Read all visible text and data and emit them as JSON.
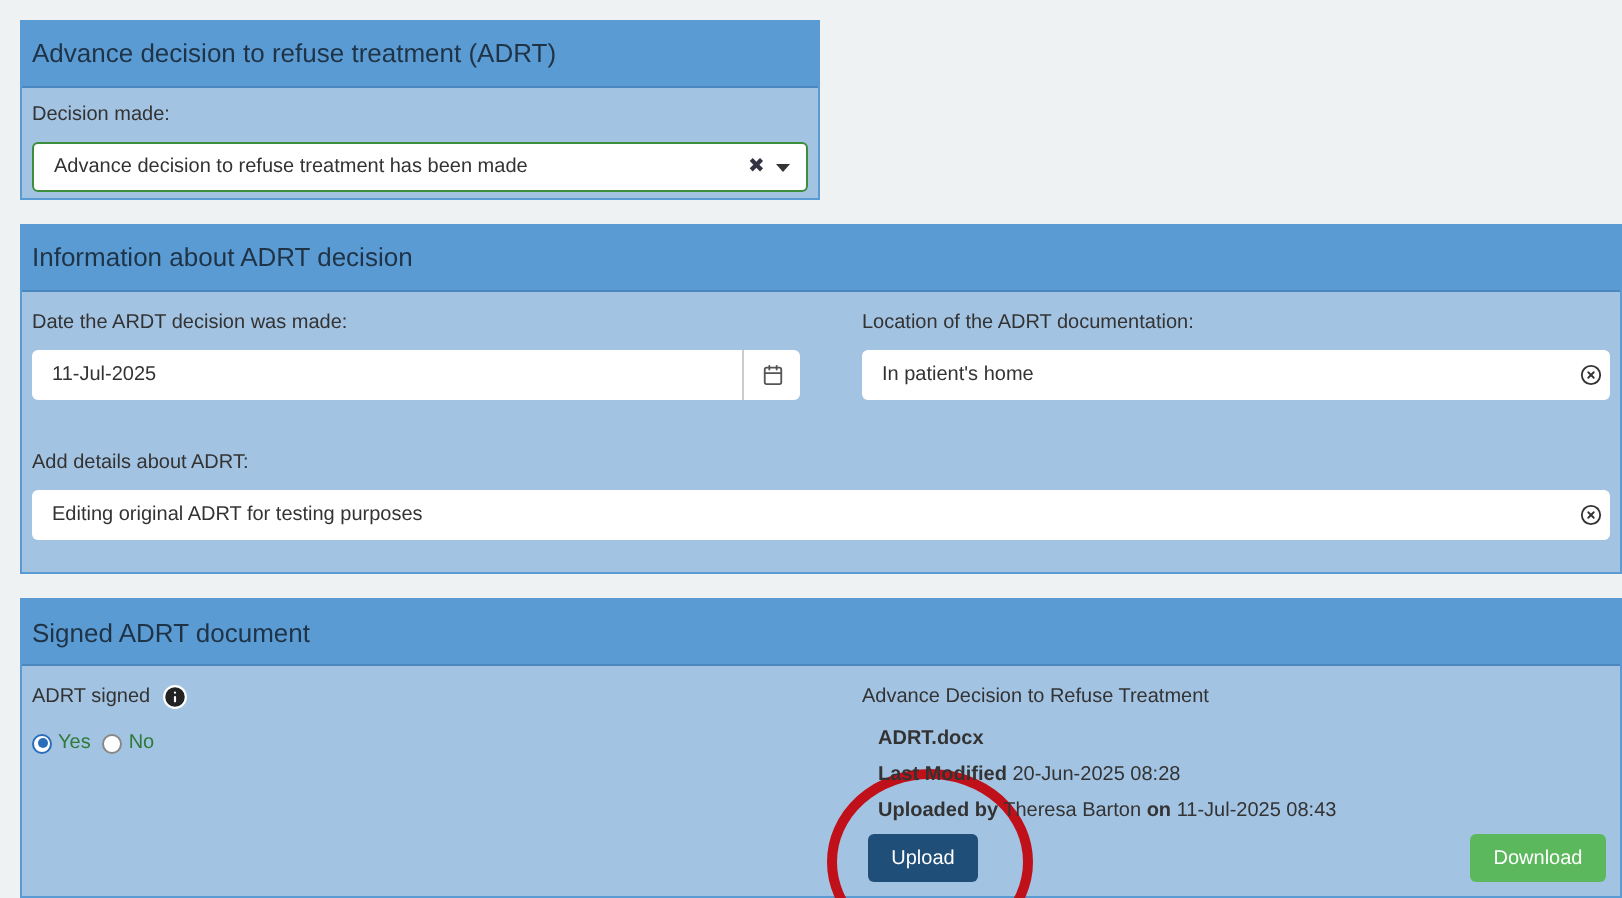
{
  "decision_panel": {
    "title": "Advance decision to refuse treatment (ADRT)",
    "label": "Decision made:",
    "value": "Advance decision to refuse treatment has been made",
    "clear_icon": "✖"
  },
  "info_panel": {
    "title": "Information about ADRT decision",
    "date": {
      "label": "Date the ARDT decision was made:",
      "value": "11-Jul-2025"
    },
    "location": {
      "label": "Location of the ADRT documentation:",
      "value": "In patient's home"
    },
    "details": {
      "label": "Add details about ADRT:",
      "value": "Editing original ADRT for testing purposes"
    }
  },
  "signed_panel": {
    "title": "Signed ADRT document",
    "signed_label": "ADRT signed",
    "options": [
      {
        "label": "Yes",
        "selected": true
      },
      {
        "label": "No",
        "selected": false
      }
    ],
    "document_heading": "Advance Decision to Refuse Treatment",
    "file_name": "ADRT.docx",
    "modified": "**Last Modified** 20-Jun-2025 08:28",
    "uploaded": "**Uploaded by** Theresa Barton **on** 11-Jul-2025 08:43",
    "upload_button": "Upload",
    "download_button": "Download"
  }
}
